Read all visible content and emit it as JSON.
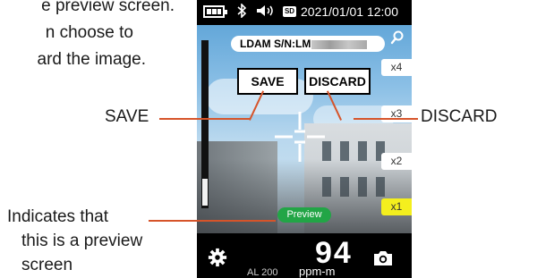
{
  "intro": {
    "line1": "e preview screen.",
    "line2": "n choose to",
    "line3": "ard the image."
  },
  "device": {
    "status": {
      "datetime": "2021/01/01 12:00",
      "sd_label": "SD"
    },
    "device_label": {
      "text": "LDAM S/N:LM"
    },
    "buttons": {
      "save": "SAVE",
      "discard": "DISCARD"
    },
    "zoom_levels": [
      "x4",
      "x3",
      "x2",
      "x1"
    ],
    "active_zoom": "x1",
    "preview_label": "Preview",
    "reading": {
      "value": "94",
      "unit": "ppm-m",
      "alarm": "AL  200"
    }
  },
  "callouts": {
    "save": "SAVE",
    "discard": "DISCARD",
    "preview_line1": "Indicates that",
    "preview_line2": "this is a preview",
    "preview_line3": "screen"
  },
  "colors": {
    "callout_line": "#d6542a",
    "preview_green": "#22a546",
    "active_zoom_yellow": "#f4ef1e"
  }
}
